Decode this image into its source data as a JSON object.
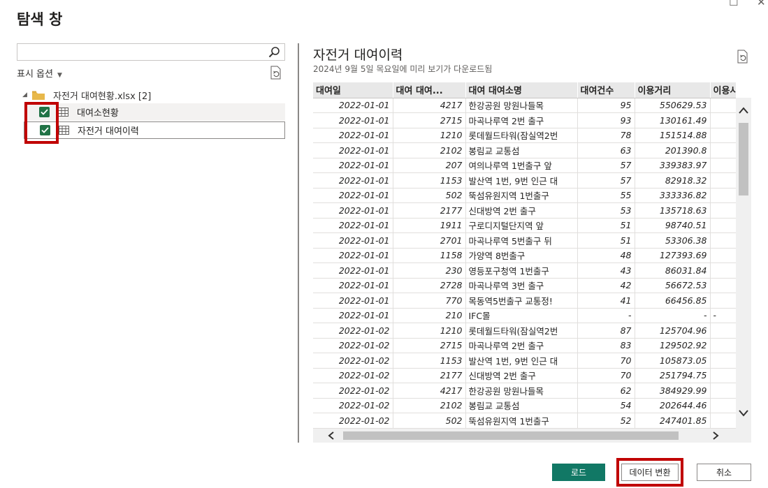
{
  "dialog": {
    "title": "탐색 창",
    "maximize_glyph": "☐",
    "close_glyph": "✕"
  },
  "navigator": {
    "search": {
      "value": "",
      "placeholder": ""
    },
    "display_options_label": "표시 옵션",
    "file_node": {
      "label": "자전거 대여현황.xlsx [2]"
    },
    "items": [
      {
        "label": "대여소현황",
        "checked": true
      },
      {
        "label": "자전거 대여이력",
        "checked": true
      }
    ]
  },
  "preview": {
    "title": "자전거 대여이력",
    "subtitle": "2024년 9월 5일 목요일에 미리 보기가 다운로드됨",
    "columns": [
      "대여일",
      "대여 대여...",
      "대여 대여소명",
      "대여건수",
      "이용거리",
      "이용시간"
    ],
    "rows": [
      [
        "2022-01-01",
        "4217",
        "한강공원 망원나들목",
        "95",
        "550629.53",
        ""
      ],
      [
        "2022-01-01",
        "2715",
        "마곡나루역 2번 출구",
        "93",
        "130161.49",
        ""
      ],
      [
        "2022-01-01",
        "1210",
        "롯데월드타워(잠실역2번",
        "78",
        "151514.88",
        ""
      ],
      [
        "2022-01-01",
        "2102",
        "봉림교 교통섬",
        "63",
        "201390.8",
        ""
      ],
      [
        "2022-01-01",
        "207",
        "여의나루역 1번출구 앞",
        "57",
        "339383.97",
        ""
      ],
      [
        "2022-01-01",
        "1153",
        "발산역 1번, 9번 인근 대",
        "57",
        "82918.32",
        ""
      ],
      [
        "2022-01-01",
        "502",
        "뚝섬유원지역 1번출구",
        "55",
        "333336.82",
        ""
      ],
      [
        "2022-01-01",
        "2177",
        "신대방역 2번 출구",
        "53",
        "135718.63",
        ""
      ],
      [
        "2022-01-01",
        "1911",
        "구로디지털단지역 앞",
        "51",
        "98740.51",
        ""
      ],
      [
        "2022-01-01",
        "2701",
        "마곡나루역 5번출구 뒤",
        "51",
        "53306.38",
        ""
      ],
      [
        "2022-01-01",
        "1158",
        "가양역 8번출구",
        "48",
        "127393.69",
        ""
      ],
      [
        "2022-01-01",
        "230",
        "영등포구청역 1번출구",
        "43",
        "86031.84",
        ""
      ],
      [
        "2022-01-01",
        "2728",
        "마곡나루역 3번 출구",
        "42",
        "56672.53",
        ""
      ],
      [
        "2022-01-01",
        "770",
        "목동역5번출구 교통정!",
        "41",
        "66456.85",
        ""
      ],
      [
        "2022-01-01",
        "210",
        "IFC몰",
        "-",
        "-",
        "-"
      ],
      [
        "2022-01-02",
        "1210",
        "롯데월드타워(잠실역2번",
        "87",
        "125704.96",
        ""
      ],
      [
        "2022-01-02",
        "2715",
        "마곡나루역 2번 출구",
        "83",
        "129502.92",
        ""
      ],
      [
        "2022-01-02",
        "1153",
        "발산역 1번, 9번 인근 대",
        "70",
        "105873.05",
        ""
      ],
      [
        "2022-01-02",
        "2177",
        "신대방역 2번 출구",
        "70",
        "251794.75",
        ""
      ],
      [
        "2022-01-02",
        "4217",
        "한강공원 망원나들목",
        "62",
        "384929.99",
        ""
      ],
      [
        "2022-01-02",
        "2102",
        "봉림교 교통섬",
        "54",
        "202644.46",
        ""
      ],
      [
        "2022-01-02",
        "502",
        "뚝섬유원지역 1번출구",
        "52",
        "247401.85",
        ""
      ],
      [
        "",
        "",
        "",
        "",
        "",
        ""
      ]
    ]
  },
  "buttons": {
    "load": "로드",
    "transform": "데이터 변환",
    "cancel": "취소"
  },
  "colors": {
    "accent_green": "#117865",
    "checkbox_green": "#217346",
    "highlight_red": "#c00000"
  },
  "icons": [
    "search-icon",
    "chevron-down-icon",
    "refresh-icon",
    "folder-icon",
    "table-icon",
    "checkbox-checked-icon",
    "scroll-up-icon",
    "scroll-down-icon",
    "scroll-left-icon",
    "scroll-right-icon"
  ]
}
